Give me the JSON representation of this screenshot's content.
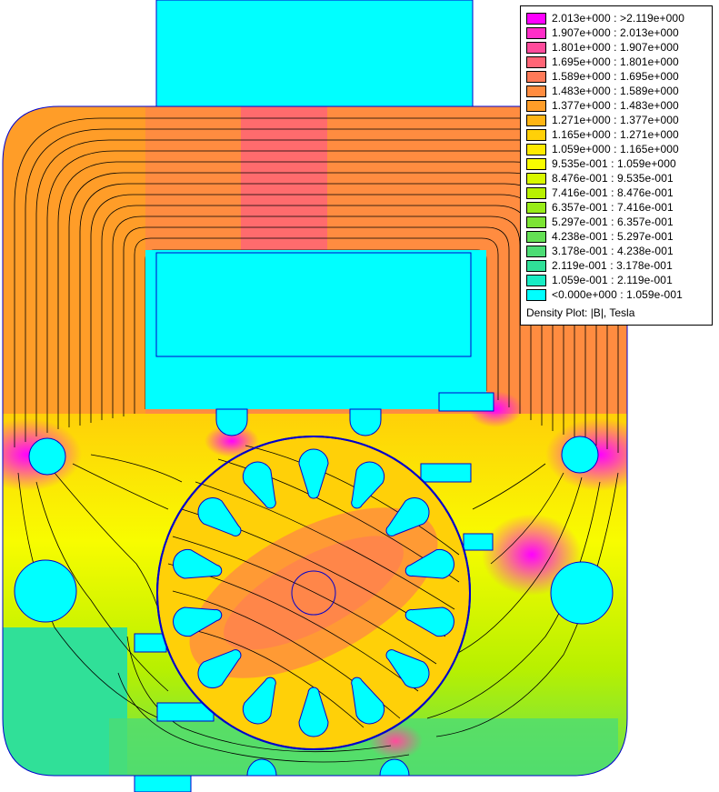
{
  "chart_data": {
    "type": "heatmap",
    "title": "Density Plot: |B|, Tesla",
    "quantity": "|B|",
    "unit": "Tesla",
    "legend_position": "top-right",
    "colorbar": [
      {
        "range": "2.013e+000 : >2.119e+000",
        "color": "#ff00ff"
      },
      {
        "range": "1.907e+000 : 2.013e+000",
        "color": "#ff2ec8"
      },
      {
        "range": "1.801e+000 : 1.907e+000",
        "color": "#ff4c9c"
      },
      {
        "range": "1.695e+000 : 1.801e+000",
        "color": "#ff6576"
      },
      {
        "range": "1.589e+000 : 1.695e+000",
        "color": "#ff7a58"
      },
      {
        "range": "1.483e+000 : 1.589e+000",
        "color": "#ff8c40"
      },
      {
        "range": "1.377e+000 : 1.483e+000",
        "color": "#ff9d28"
      },
      {
        "range": "1.271e+000 : 1.377e+000",
        "color": "#ffb514"
      },
      {
        "range": "1.165e+000 : 1.271e+000",
        "color": "#ffd008"
      },
      {
        "range": "1.059e+000 : 1.165e+000",
        "color": "#ffea00"
      },
      {
        "range": "9.535e-001 : 1.059e+000",
        "color": "#f8fc00"
      },
      {
        "range": "8.476e-001 : 9.535e-001",
        "color": "#d8f800"
      },
      {
        "range": "7.416e-001 : 8.476e-001",
        "color": "#b8f000"
      },
      {
        "range": "6.357e-001 : 7.416e-001",
        "color": "#98ec18"
      },
      {
        "range": "5.297e-001 : 6.357e-001",
        "color": "#7ce434"
      },
      {
        "range": "4.238e-001 : 5.297e-001",
        "color": "#64e054"
      },
      {
        "range": "3.178e-001 : 4.238e-001",
        "color": "#4cdc74"
      },
      {
        "range": "2.119e-001 : 3.178e-001",
        "color": "#30e098"
      },
      {
        "range": "1.059e-001 : 2.119e-001",
        "color": "#18ecc4"
      },
      {
        "range": "<0.000e+000 : 1.059e-001",
        "color": "#00ffff"
      }
    ],
    "geometry_colors": {
      "boundary": "#0000cc",
      "flux_line": "#000000",
      "air": "#00ffff"
    }
  }
}
